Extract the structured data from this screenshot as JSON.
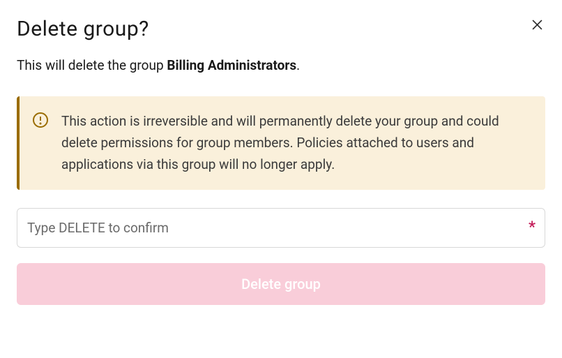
{
  "modal": {
    "title": "Delete group?",
    "subtitle_prefix": "This will delete the group ",
    "subtitle_group_name": "Billing Administrators",
    "subtitle_suffix": "."
  },
  "warning": {
    "text": "This action is irreversible and will permanently delete your group and could delete permissions for group members. Policies attached to users and applications via this group will no longer apply."
  },
  "input": {
    "placeholder": "Type DELETE to confirm",
    "value": "",
    "required_marker": "*"
  },
  "actions": {
    "delete_label": "Delete group"
  },
  "colors": {
    "warning_bg": "#faf0db",
    "warning_border": "#9a6c00",
    "delete_btn_bg": "#f9cdd9",
    "required_color": "#c41e5a"
  }
}
